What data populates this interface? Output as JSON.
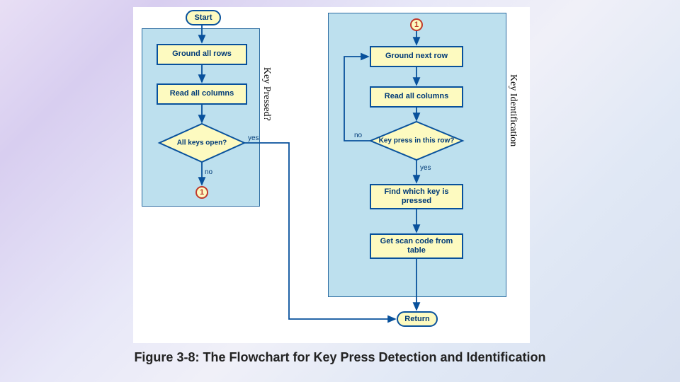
{
  "caption": "Figure 3-8: The Flowchart for Key Press Detection and Identification",
  "panels": {
    "left_label": "Key Pressed?",
    "right_label": "Key Identification"
  },
  "nodes": {
    "start": "Start",
    "ground_all_rows": "Ground all rows",
    "read_all_columns_left": "Read all columns",
    "all_keys_open": "All keys open?",
    "conn1_left": "1",
    "conn1_right": "1",
    "ground_next_row": "Ground next row",
    "read_all_columns_right": "Read all columns",
    "key_press_row": "Key press in this row?",
    "find_which_key": "Find which key is pressed",
    "get_scan_code": "Get scan code from table",
    "return": "Return"
  },
  "edges": {
    "yes": "yes",
    "no": "no"
  }
}
